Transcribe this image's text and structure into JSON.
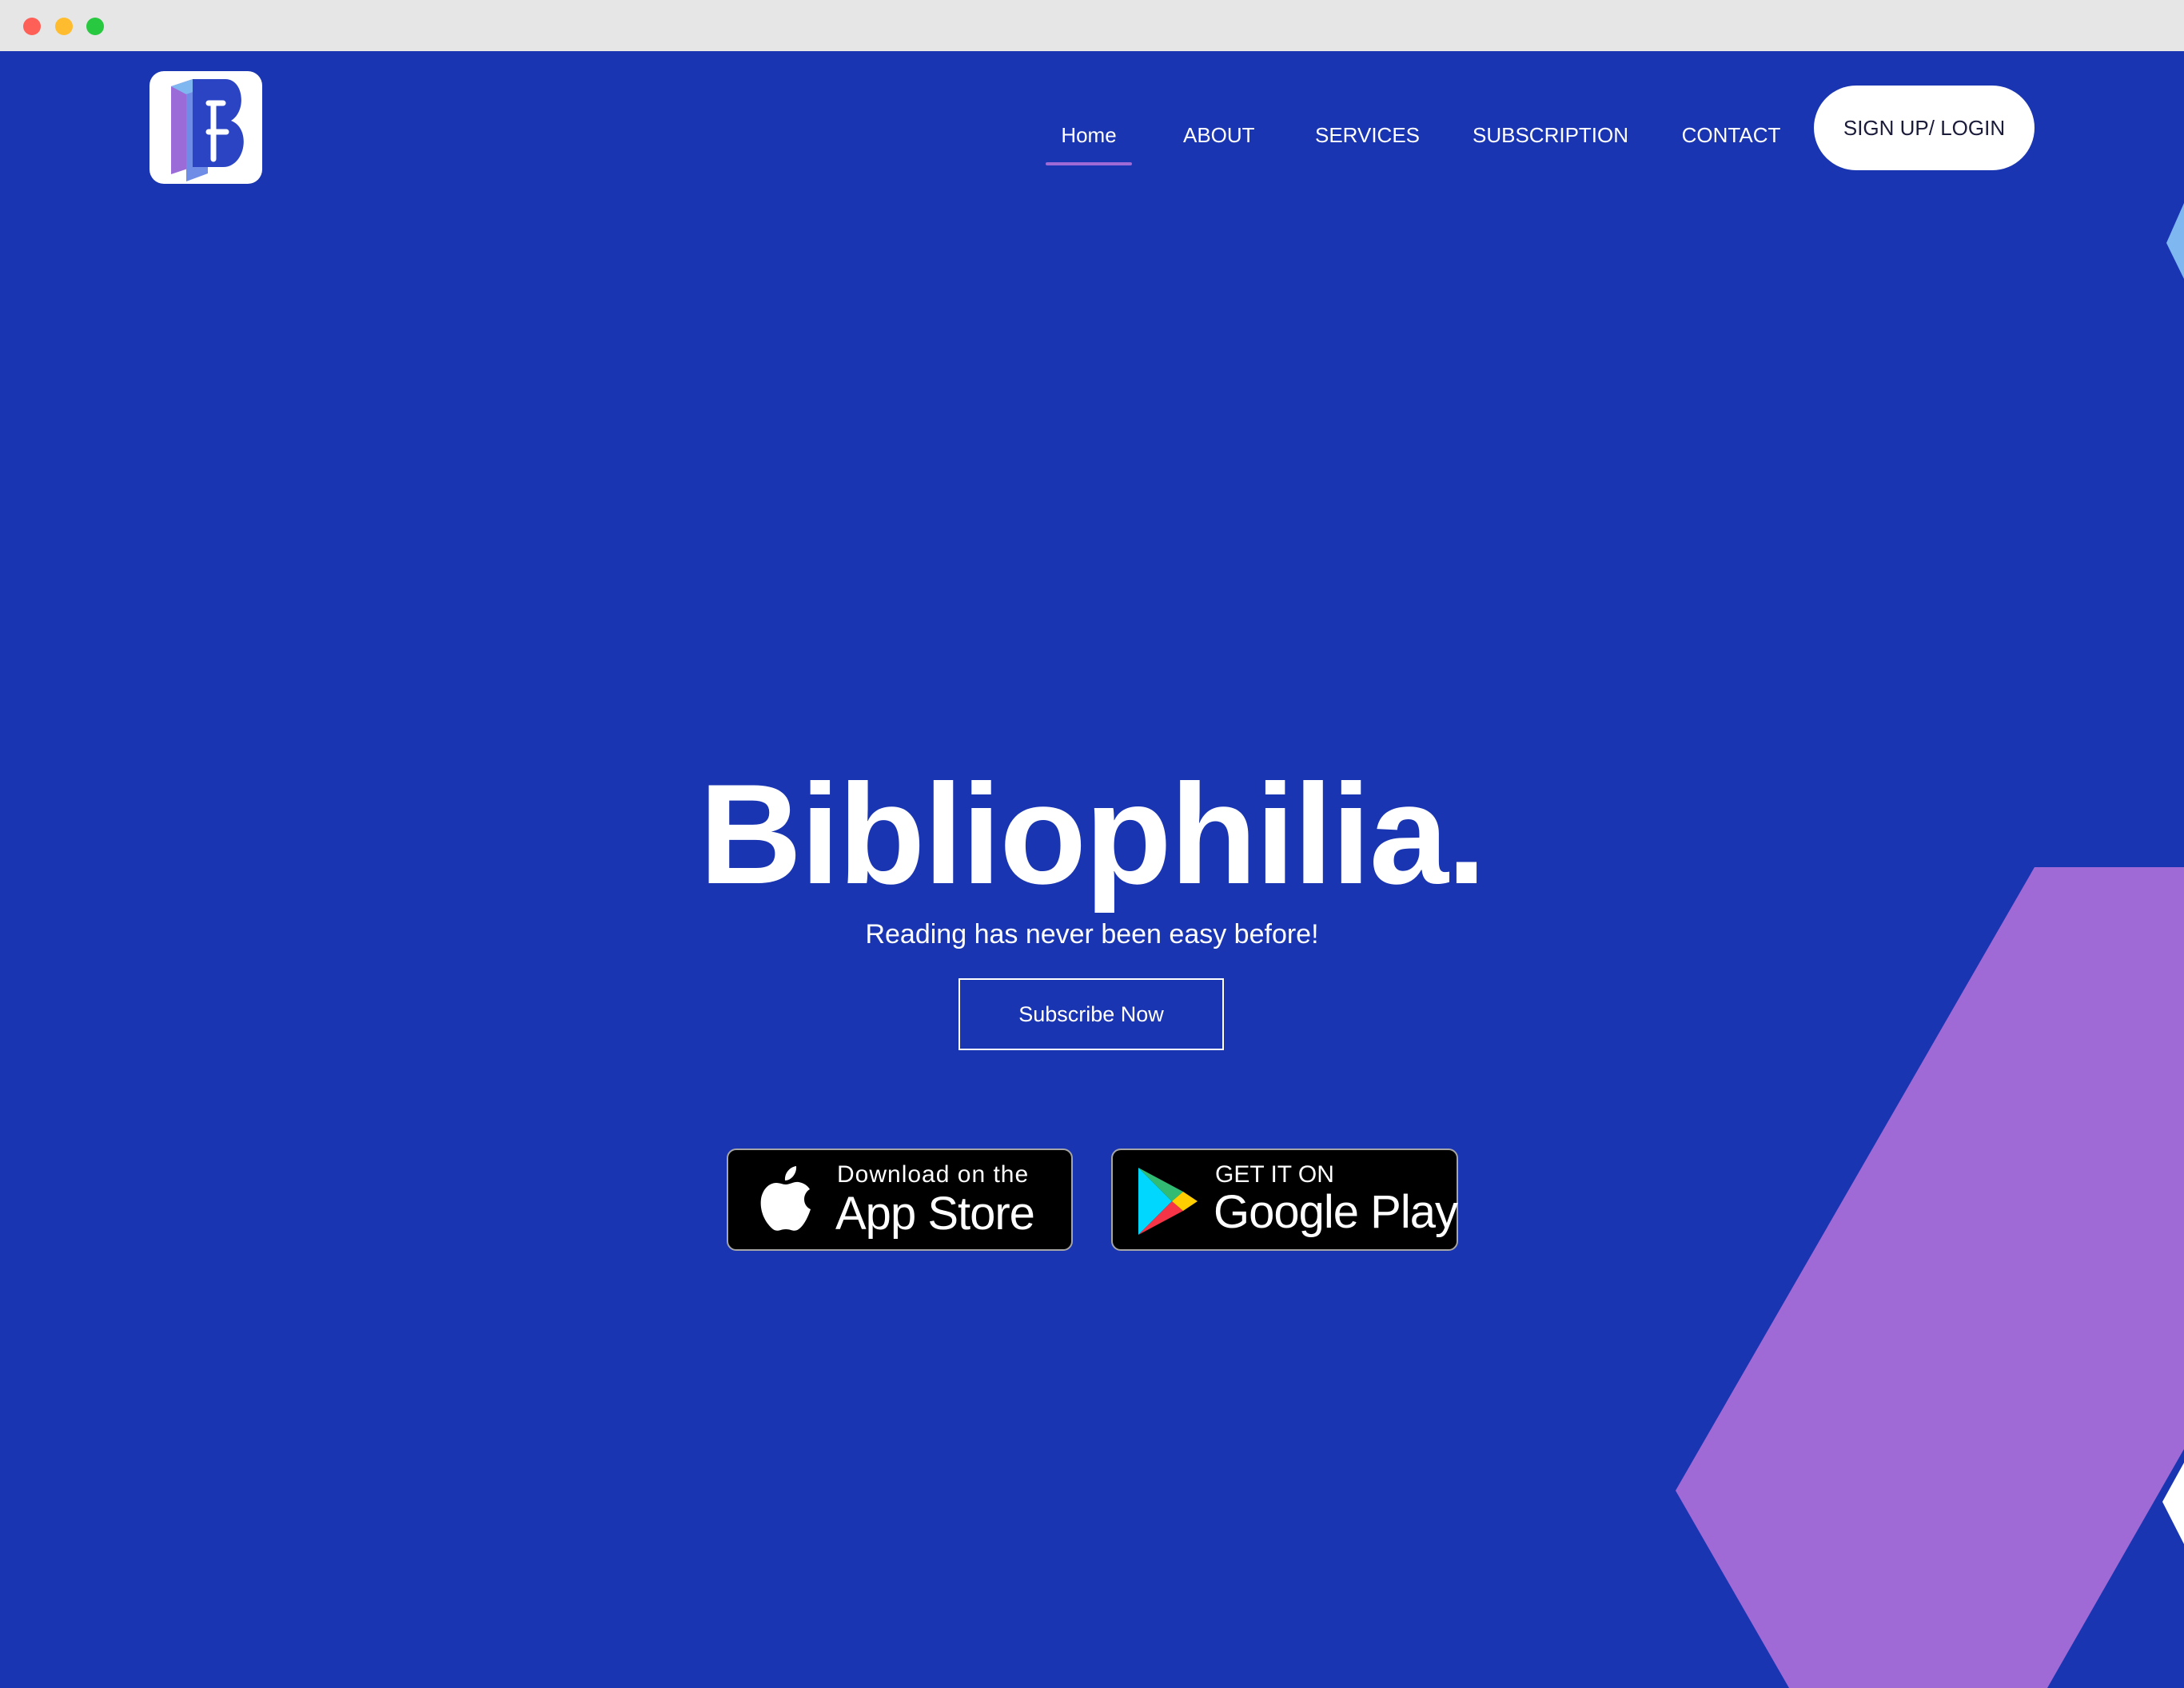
{
  "browser": {
    "controls": [
      "close",
      "minimize",
      "maximize"
    ]
  },
  "brand": {
    "logo_letter": "B",
    "colors": {
      "background": "#1a35b2",
      "accent_purple": "#a06ad6",
      "accent_light_blue": "#7fb7f0",
      "white": "#ffffff"
    }
  },
  "nav": {
    "items": [
      {
        "label": "Home",
        "active": true
      },
      {
        "label": "ABOUT",
        "active": false
      },
      {
        "label": "SERVICES",
        "active": false
      },
      {
        "label": "SUBSCRIPTION",
        "active": false
      },
      {
        "label": "CONTACT",
        "active": false
      }
    ],
    "cta_label": "SIGN UP/ LOGIN"
  },
  "hero": {
    "title": "Bibliophilia.",
    "subtitle": "Reading has never been easy before!",
    "button_label": "Subscribe Now"
  },
  "badges": {
    "apple": {
      "small": "Download on the",
      "big": "App Store",
      "icon": "apple-icon"
    },
    "google": {
      "small": "GET IT ON",
      "big": "Google Play",
      "icon": "google-play-icon"
    }
  }
}
